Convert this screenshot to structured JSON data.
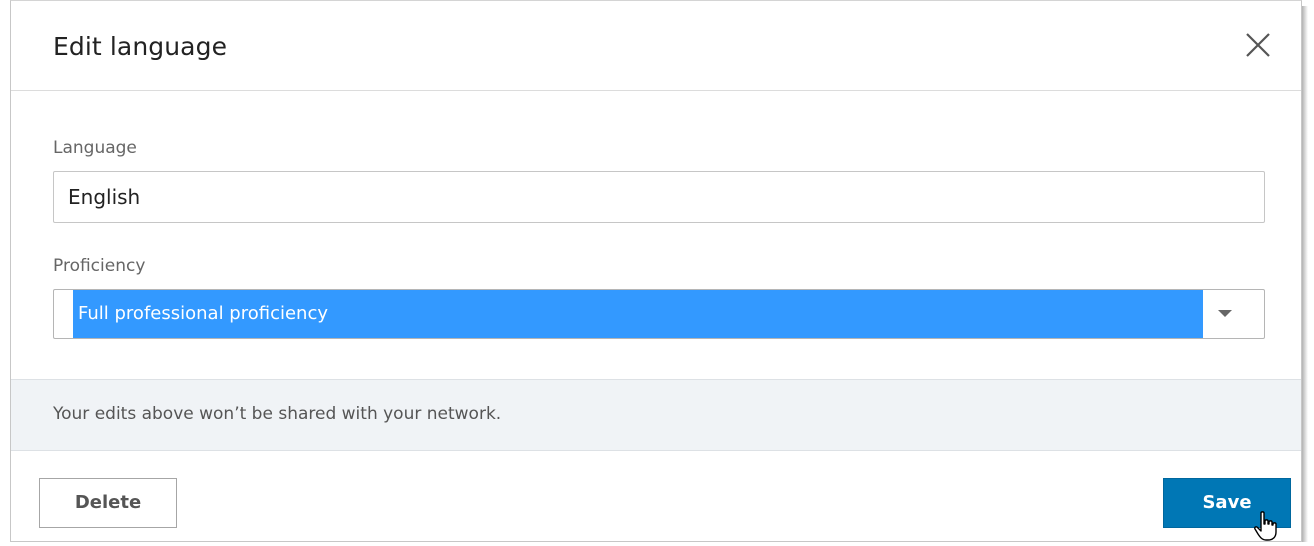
{
  "dialog": {
    "title": "Edit language",
    "close_icon": "close-icon"
  },
  "form": {
    "language": {
      "label": "Language",
      "value": "English"
    },
    "proficiency": {
      "label": "Proficiency",
      "selected": "Full professional proficiency",
      "arrow_icon": "chevron-down-icon"
    }
  },
  "notice": {
    "text": "Your edits above won’t be shared with your network."
  },
  "footer": {
    "delete_label": "Delete",
    "save_label": "Save"
  },
  "colors": {
    "accent": "#0077b5",
    "selection": "#3399ff",
    "notice_bg": "#f0f3f6"
  }
}
